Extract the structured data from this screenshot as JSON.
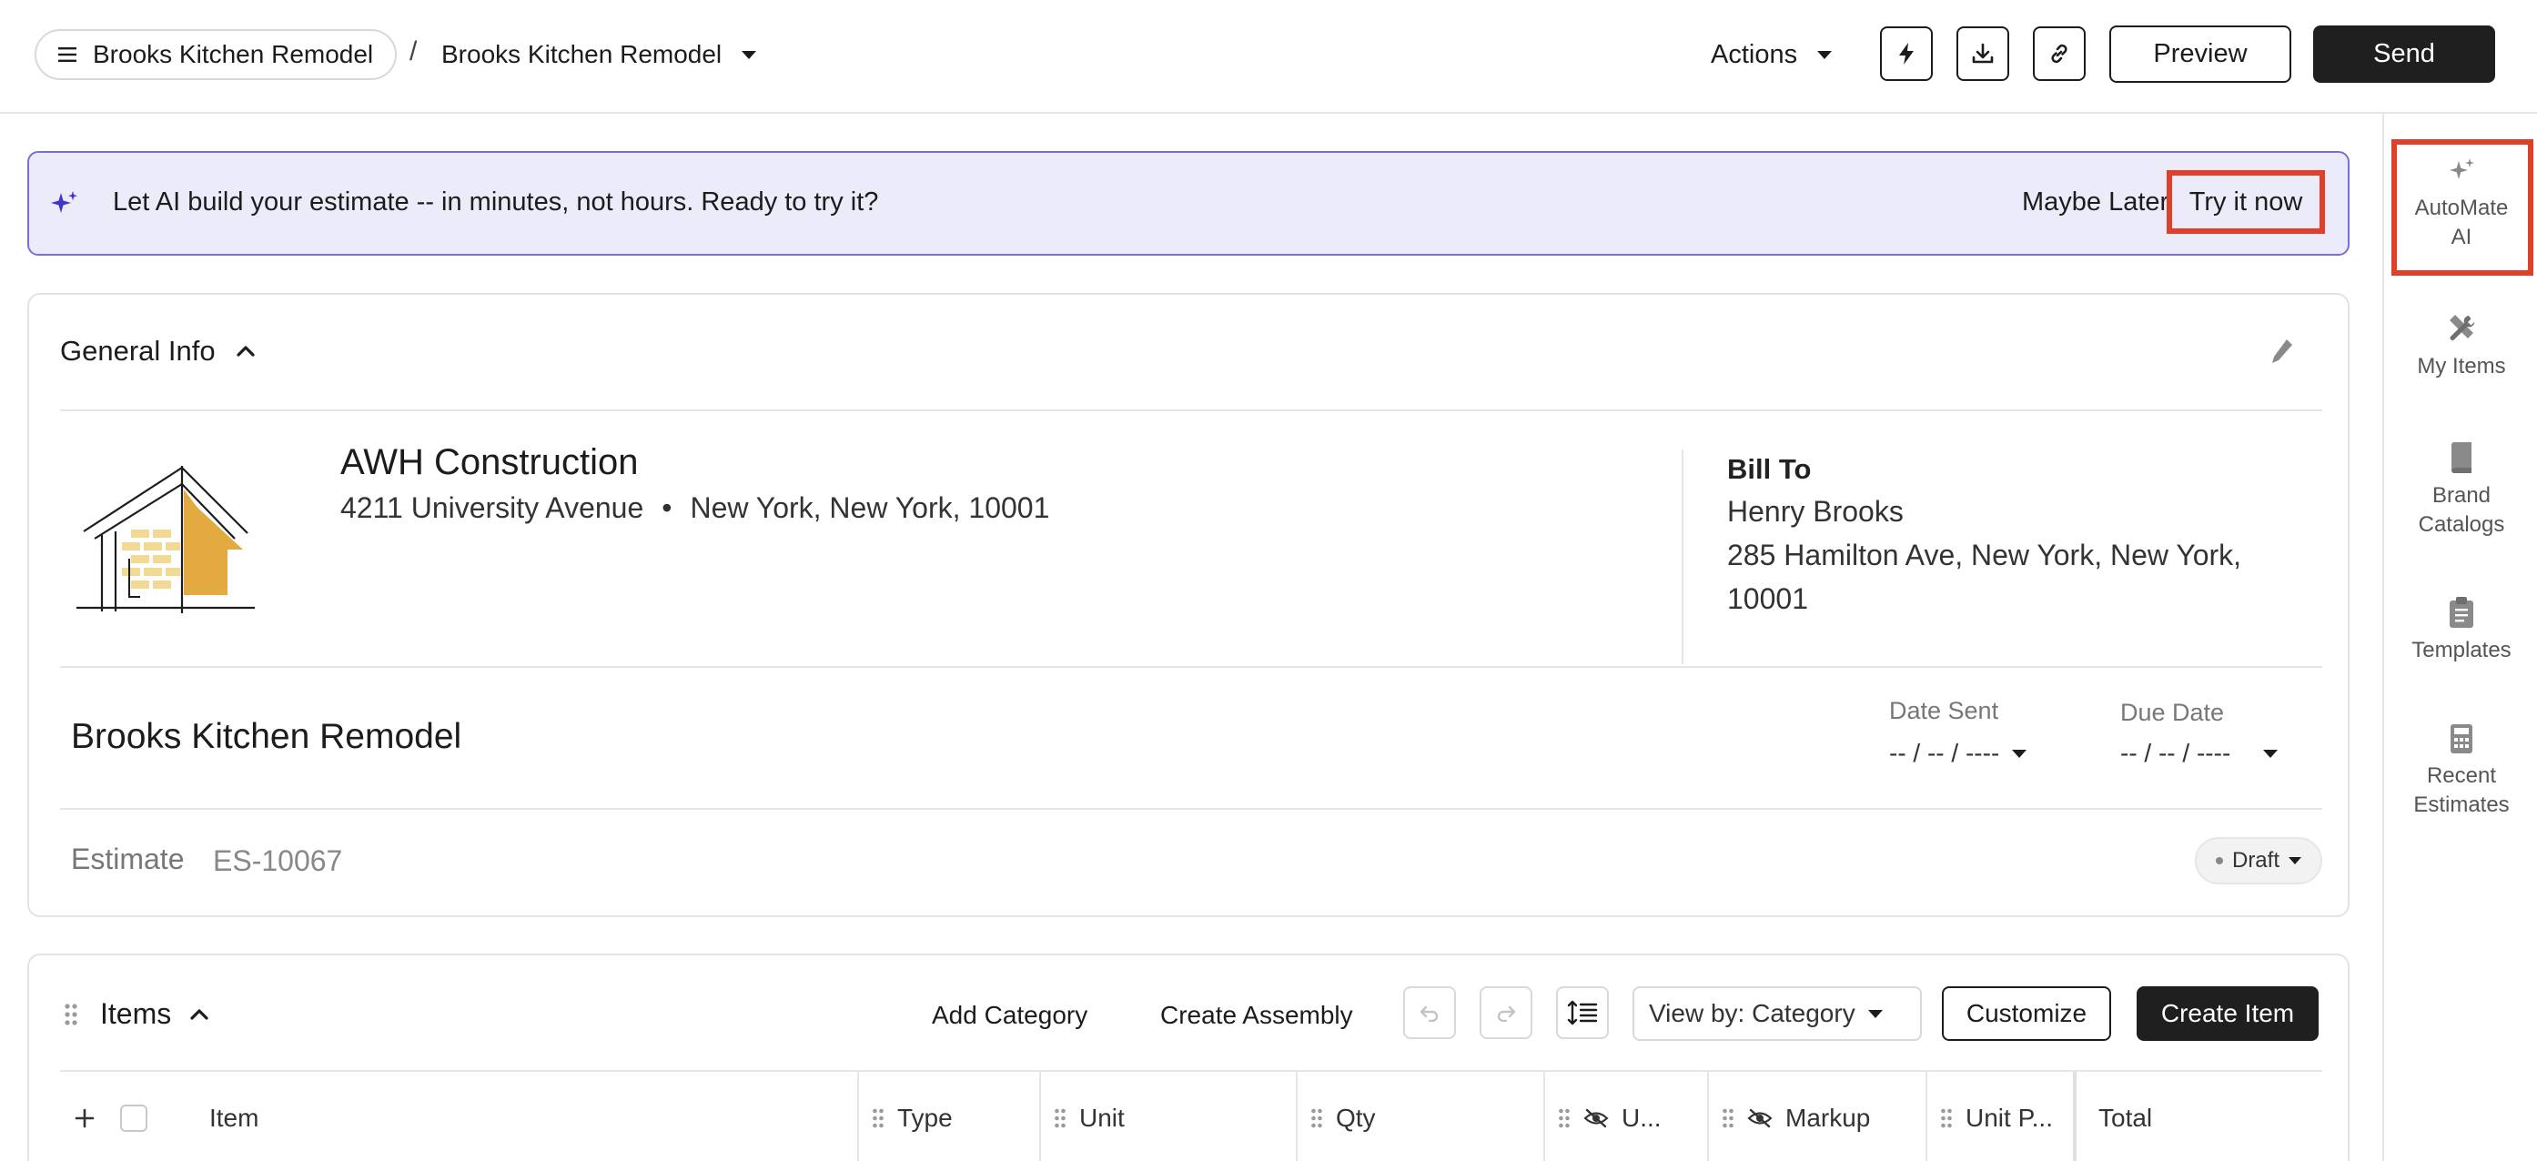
{
  "header": {
    "breadcrumb_root": "Brooks Kitchen Remodel",
    "breadcrumb_sep": "/",
    "breadcrumb_current": "Brooks Kitchen Remodel",
    "actions_label": "Actions",
    "preview_label": "Preview",
    "send_label": "Send"
  },
  "banner": {
    "text": "Let AI build your estimate -- in minutes, not hours. Ready to try it?",
    "later_label": "Maybe Later",
    "try_label": "Try it now"
  },
  "sidebar": {
    "items": [
      {
        "line1": "AutoMate",
        "line2": "AI"
      },
      {
        "line1": "My Items",
        "line2": ""
      },
      {
        "line1": "Brand",
        "line2": "Catalogs"
      },
      {
        "line1": "Templates",
        "line2": ""
      },
      {
        "line1": "Recent",
        "line2": "Estimates"
      }
    ]
  },
  "general": {
    "title": "General Info",
    "company_name": "AWH Construction",
    "company_street": "4211 University Avenue",
    "company_bullet": "•",
    "company_city": "New York, New York, 10001",
    "bill_to_title": "Bill To",
    "bill_to_name": "Henry Brooks",
    "bill_to_addr1": "285 Hamilton Ave, New York, New York,",
    "bill_to_addr2": "10001",
    "project_name": "Brooks Kitchen Remodel",
    "date_sent_label": "Date Sent",
    "date_sent_value": "-- / -- / ----",
    "due_date_label": "Due Date",
    "due_date_value": "-- / -- / ----",
    "estimate_label": "Estimate",
    "estimate_number": "ES-10067",
    "status": "Draft"
  },
  "items": {
    "title": "Items",
    "add_category": "Add Category",
    "create_assembly": "Create Assembly",
    "view_by": "View by: Category",
    "customize": "Customize",
    "create_item": "Create Item",
    "columns": {
      "item": "Item",
      "type": "Type",
      "unit": "Unit",
      "qty": "Qty",
      "unit_cost": "U...",
      "markup": "Markup",
      "unit_price": "Unit P...",
      "total": "Total"
    }
  },
  "colors": {
    "accent_highlight": "#e0402a",
    "banner_bg": "#ecebfa",
    "banner_border": "#7a6fd8",
    "primary_dark": "#1f1f1f",
    "logo_gold": "#e2aa40"
  }
}
